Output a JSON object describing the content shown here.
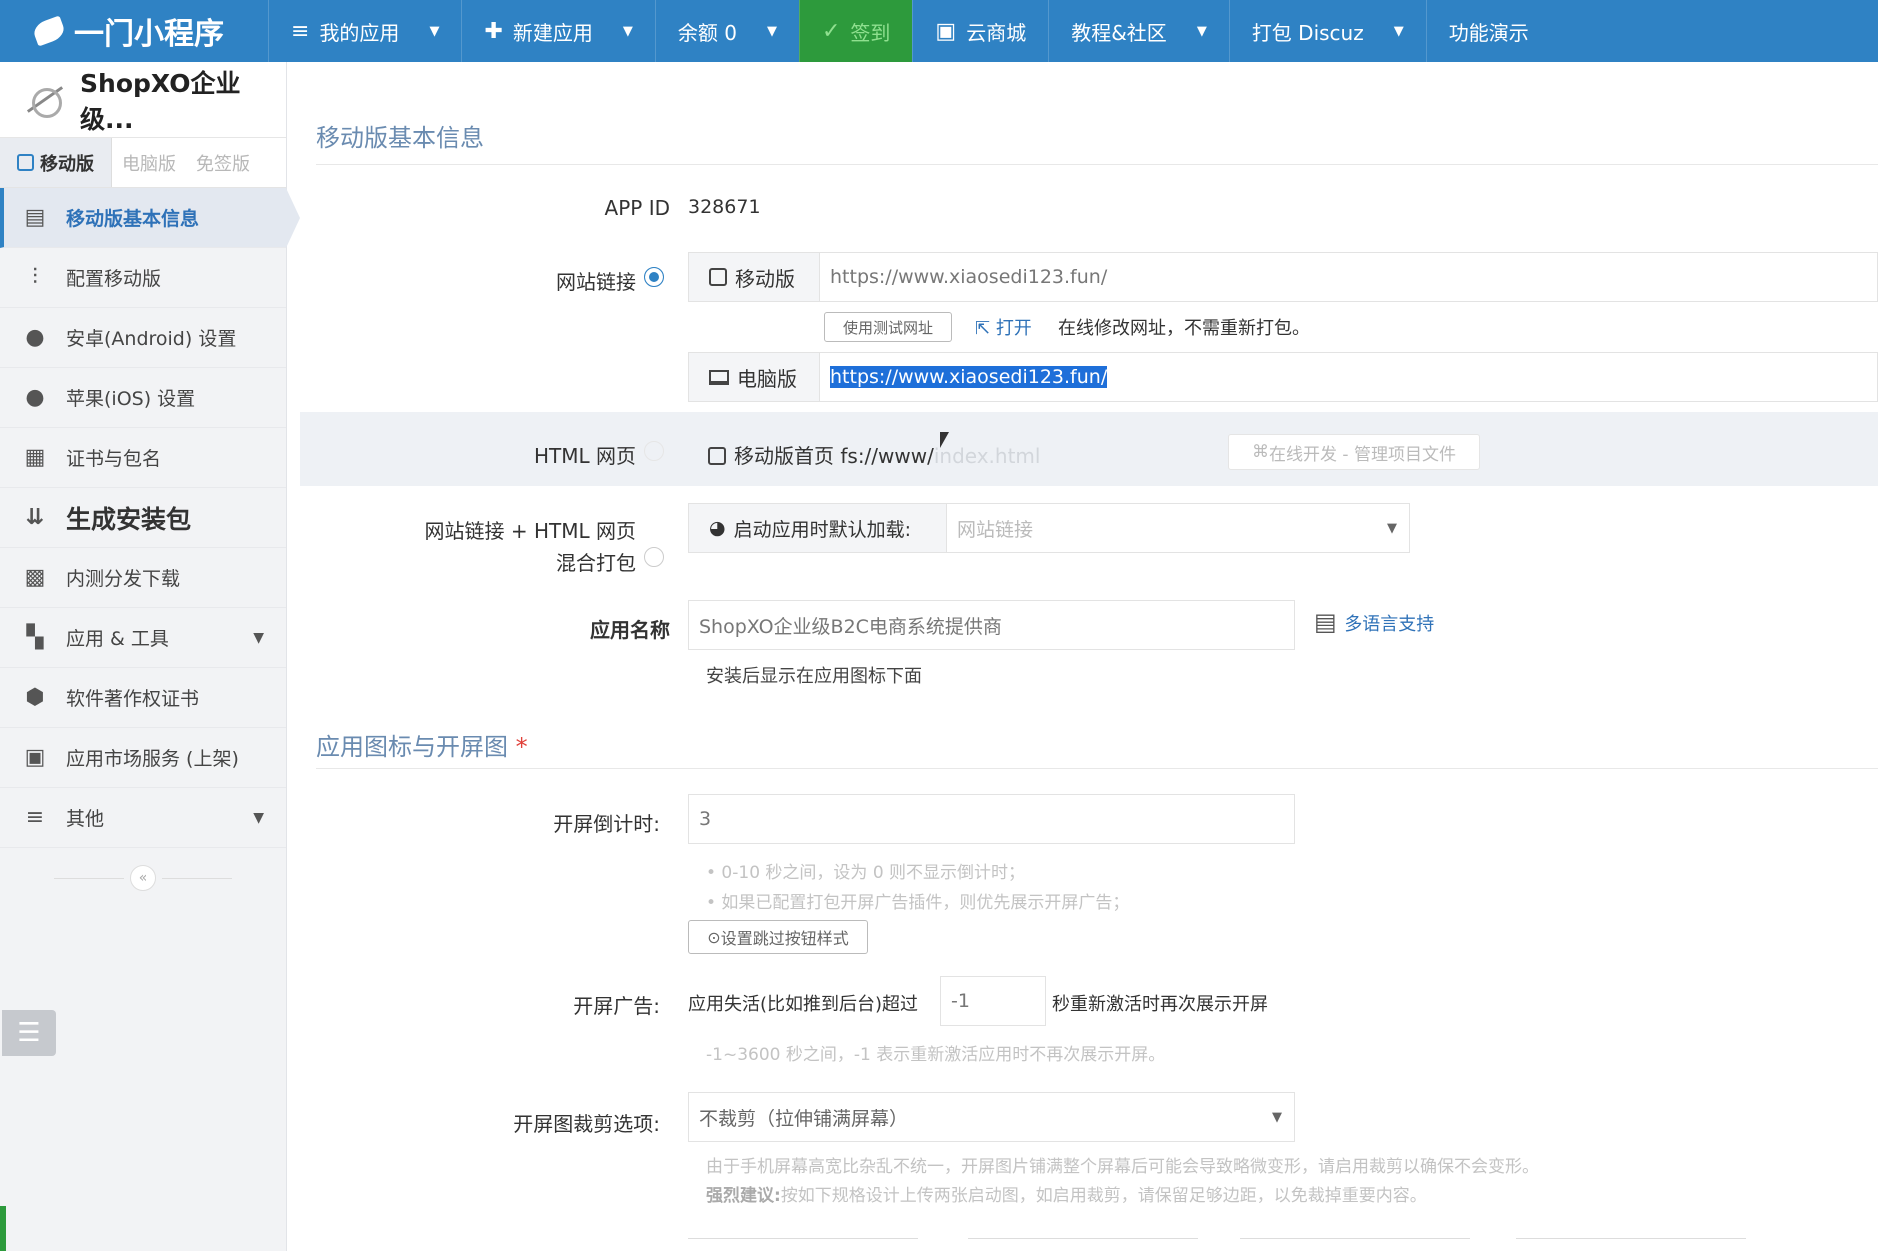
{
  "topbar": {
    "logo": "一门小程序",
    "nav": [
      {
        "label": "我的应用",
        "icon": "list-icon",
        "caret": true
      },
      {
        "label": "新建应用",
        "icon": "plus-icon",
        "caret": true
      },
      {
        "label": "余额 0",
        "icon": "",
        "caret": true
      },
      {
        "label": "签到",
        "icon": "check-icon",
        "caret": false
      },
      {
        "label": "云商城",
        "icon": "store-icon",
        "caret": false
      },
      {
        "label": "教程&社区",
        "icon": "",
        "caret": true
      },
      {
        "label": "打包 Discuz",
        "icon": "",
        "caret": true
      },
      {
        "label": "功能演示",
        "icon": "",
        "caret": false
      }
    ]
  },
  "sidebar": {
    "app_name": "ShopXO企业级...",
    "tabs": [
      "移动版",
      "电脑版",
      "免签版"
    ],
    "items": [
      {
        "label": "移动版基本信息",
        "icon": "document-icon",
        "active": true
      },
      {
        "label": "配置移动版",
        "icon": "sliders-icon"
      },
      {
        "label": "安卓(Android) 设置",
        "icon": "android-icon"
      },
      {
        "label": "苹果(iOS) 设置",
        "icon": "apple-icon"
      },
      {
        "label": "证书与包名",
        "icon": "certificate-icon"
      },
      {
        "label": "生成安装包",
        "icon": "sort-download-icon",
        "big": true
      },
      {
        "label": "内测分发下载",
        "icon": "qrcode-icon"
      },
      {
        "label": "应用 & 工具",
        "icon": "grid-icon",
        "expand": true
      },
      {
        "label": "软件著作权证书",
        "icon": "shield-icon"
      },
      {
        "label": "应用市场服务 (上架)",
        "icon": "market-icon"
      },
      {
        "label": "其他",
        "icon": "menu-icon",
        "expand": true
      }
    ]
  },
  "main": {
    "section1_title": "移动版基本信息",
    "app_id_label": "APP ID",
    "app_id_value": "328671",
    "website_link_label": "网站链接",
    "mobile_addon": "移动版",
    "mobile_url": "https://www.xiaosedi123.fun/",
    "use_test_url_btn": "使用测试网址",
    "open_link": "打开",
    "online_edit_hint": "在线修改网址，不需重新打包。",
    "pc_addon": "电脑版",
    "pc_url": "https://www.xiaosedi123.fun/",
    "html_label": "HTML 网页",
    "html_mobile_home": "移动版首页 fs://www/",
    "html_mobile_home_faded": "index.html",
    "online_dev_btn": "在线开发 - 管理项目文件",
    "mix_label_1": "网站链接 + HTML 网页",
    "mix_label_2": "混合打包",
    "startup_load_addon": "启动应用时默认加载:",
    "startup_load_value": "网站链接",
    "app_name_label": "应用名称",
    "app_name_value": "ShopXO企业级B2C电商系统提供商",
    "multilang": "多语言支持",
    "app_name_hint": "安装后显示在应用图标下面",
    "section2_title": "应用图标与开屏图",
    "required_mark": "*",
    "countdown_label": "开屏倒计时:",
    "countdown_value": "3",
    "countdown_hint1": "• 0-10 秒之间，设为 0 则不显示倒计时；",
    "countdown_hint2": "• 如果已配置打包开屏广告插件，则优先展示开屏广告；",
    "skip_btn": "设置跳过按钮样式",
    "ad_label": "开屏广告:",
    "ad_text1": "应用失活(比如推到后台)超过",
    "ad_value": "-1",
    "ad_text2": "秒重新激活时再次展示开屏",
    "ad_hint": "-1~3600 秒之间，-1 表示重新激活应用时不再次展示开屏。",
    "crop_label": "开屏图裁剪选项:",
    "crop_value": "不裁剪（拉伸铺满屏幕）",
    "crop_hint1": "由于手机屏幕高宽比杂乱不统一，开屏图片铺满整个屏幕后可能会导致略微变形，请启用裁剪以确保不会变形。",
    "crop_hint2_bold": "强烈建议:",
    "crop_hint2": "按如下规格设计上传两张启动图，如启用裁剪，请保留足够边距，以免裁掉重要内容。"
  }
}
